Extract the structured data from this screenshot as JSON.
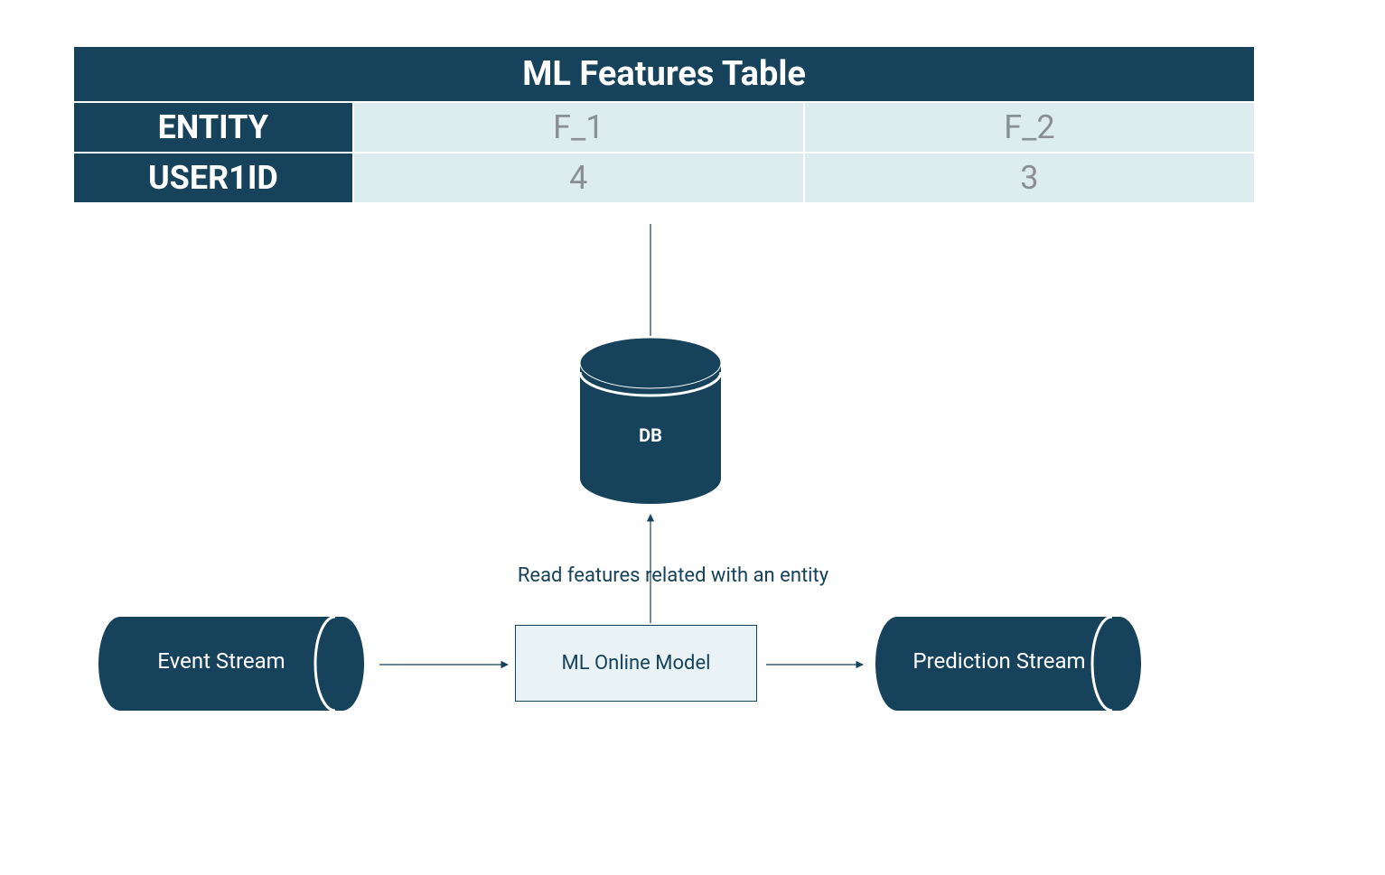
{
  "table": {
    "title": "ML Features Table",
    "header": {
      "entity": "ENTITY",
      "f1": "F_1",
      "f2": "F_2"
    },
    "row1": {
      "entity": "USER1ID",
      "f1": "4",
      "f2": "3"
    }
  },
  "db": {
    "label": "DB"
  },
  "read_label": "Read features related with an entity",
  "pipeline": {
    "event_stream": "Event Stream",
    "model": "ML Online Model",
    "prediction_stream": "Prediction Stream"
  },
  "colors": {
    "dark": "#16425b",
    "light": "#dcecef",
    "grey": "#8a8f94"
  }
}
